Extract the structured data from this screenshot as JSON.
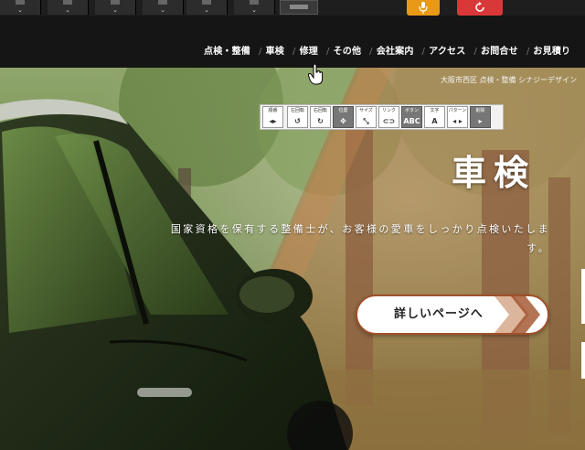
{
  "toolbar": {
    "items": [
      "dropdown-1",
      "dropdown-2",
      "dropdown-3",
      "dropdown-4",
      "dropdown-5",
      "dropdown-6"
    ],
    "chevron": "⌄",
    "mic_color": "#e89a16",
    "reset_color": "#d93838"
  },
  "nav": {
    "items": [
      {
        "label": "点検・整備"
      },
      {
        "label": "車検"
      },
      {
        "label": "修理"
      },
      {
        "label": "その他"
      },
      {
        "label": "会社案内"
      },
      {
        "label": "アクセス"
      },
      {
        "label": "お問合せ"
      },
      {
        "label": "お見積り"
      }
    ],
    "separator": "/"
  },
  "hero": {
    "breadcrumb": "大阪市西区 点検・整備 シナジーデザイン",
    "title": "車検",
    "description": "国家資格を保有する整備士が、お客様の愛車をしっかり点検いたします。",
    "button_label": "詳しいページへ",
    "accent_color": "#a0502a"
  },
  "palette": {
    "buttons": [
      {
        "label": "順番",
        "icon": "◂▸"
      },
      {
        "label": "左回転",
        "icon": "↺"
      },
      {
        "label": "右回転",
        "icon": "↻"
      },
      {
        "label": "位置",
        "icon": "✥"
      },
      {
        "label": "サイズ",
        "icon": "⤡"
      },
      {
        "label": "リンク",
        "icon": "⊂⊃"
      },
      {
        "label": "ボタン",
        "icon": "ABC"
      },
      {
        "label": "文字",
        "icon": "A"
      },
      {
        "label": "パターン",
        "icon": "◂ ▸"
      },
      {
        "label": "削除",
        "icon": "▸"
      }
    ]
  }
}
